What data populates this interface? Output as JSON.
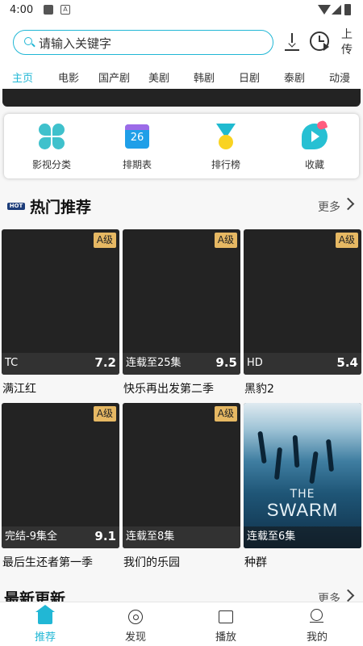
{
  "status_bar": {
    "time": "4:00"
  },
  "header": {
    "search_placeholder": "请输入关键字",
    "upload_label": "上传"
  },
  "tabs": [
    {
      "label": "主页",
      "active": true
    },
    {
      "label": "电影"
    },
    {
      "label": "国产剧"
    },
    {
      "label": "美剧"
    },
    {
      "label": "韩剧"
    },
    {
      "label": "日剧"
    },
    {
      "label": "泰剧"
    },
    {
      "label": "动漫"
    }
  ],
  "categories": [
    {
      "label": "影视分类",
      "icon": "clover-icon"
    },
    {
      "label": "排期表",
      "icon": "calendar-icon",
      "date": "26"
    },
    {
      "label": "排行榜",
      "icon": "medal-icon"
    },
    {
      "label": "收藏",
      "icon": "favorite-icon"
    }
  ],
  "hot": {
    "badge": "HOT",
    "title": "热门推荐",
    "more": "更多",
    "items": [
      {
        "title": "满江红",
        "status": "TC",
        "score": "7.2",
        "grade": "A级"
      },
      {
        "title": "快乐再出发第二季",
        "status": "连载至25集",
        "score": "9.5",
        "grade": "A级"
      },
      {
        "title": "黑豹2",
        "status": "HD",
        "score": "5.4",
        "grade": "A级"
      },
      {
        "title": "最后生还者第一季",
        "status": "完结-9集全",
        "score": "9.1",
        "grade": "A级"
      },
      {
        "title": "我们的乐园",
        "status": "连载至8集",
        "score": "",
        "grade": "A级"
      },
      {
        "title": "种群",
        "status": "连载至6集",
        "score": "",
        "grade": "",
        "poster_line1": "THE",
        "poster_line2": "SWARM"
      }
    ]
  },
  "latest": {
    "title": "最新更新",
    "more": "更多"
  },
  "bottom_nav": [
    {
      "label": "推荐",
      "active": true
    },
    {
      "label": "发现"
    },
    {
      "label": "播放"
    },
    {
      "label": "我的"
    }
  ],
  "colors": {
    "accent": "#21b7d5",
    "grade_badge": "#e6b863",
    "card_bg": "#232323"
  }
}
